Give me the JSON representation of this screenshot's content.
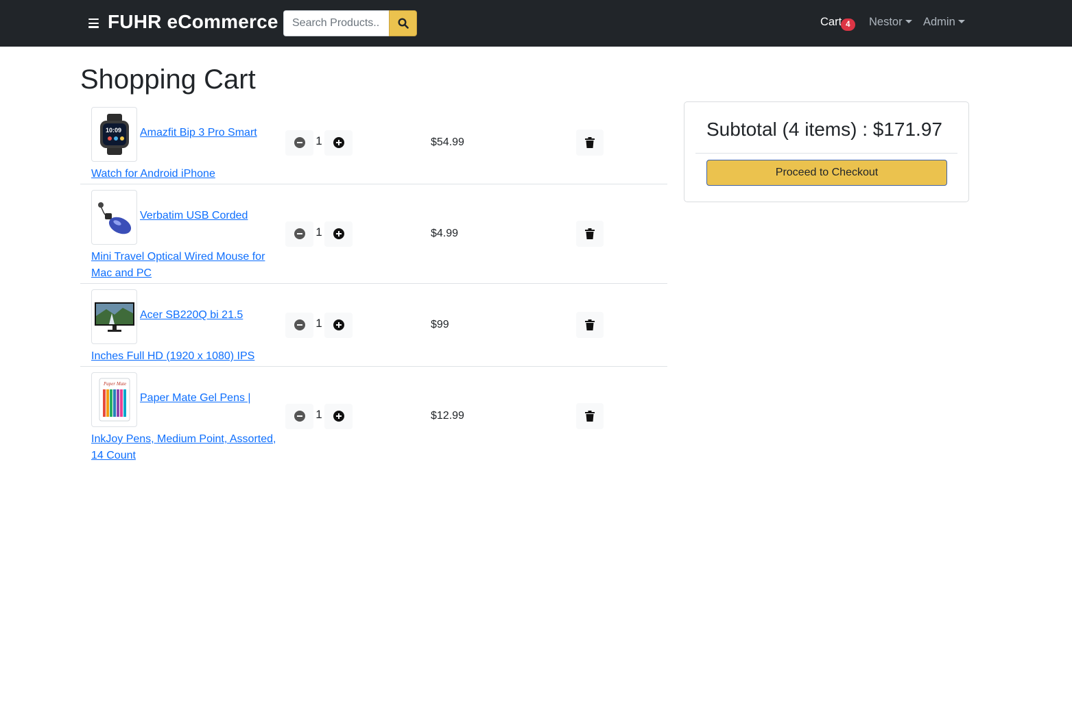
{
  "navbar": {
    "brand": "FUHR eCommerce",
    "search_placeholder": "Search Products..",
    "cart_label": "Cart",
    "cart_count": "4",
    "user_menu": "Nestor",
    "admin_menu": "Admin"
  },
  "page": {
    "title": "Shopping Cart"
  },
  "cart": {
    "items": [
      {
        "name_line1": "Amazfit Bip 3 Pro Smart",
        "name_rest": "Watch for Android iPhone",
        "quantity": "1",
        "price": "$54.99",
        "image_icon": "smartwatch-image"
      },
      {
        "name_line1": "Verbatim USB Corded",
        "name_rest": "Mini Travel Optical Wired Mouse for Mac and PC",
        "quantity": "1",
        "price": "$4.99",
        "image_icon": "mouse-image"
      },
      {
        "name_line1": "Acer SB220Q bi 21.5",
        "name_rest": "Inches Full HD (1920 x 1080) IPS",
        "quantity": "1",
        "price": "$99",
        "image_icon": "monitor-image"
      },
      {
        "name_line1": "Paper Mate Gel Pens |",
        "name_rest": "InkJoy Pens, Medium Point, Assorted, 14 Count",
        "quantity": "1",
        "price": "$12.99",
        "image_icon": "pens-image"
      }
    ]
  },
  "summary": {
    "subtotal_text": "Subtotal (4 items) : $171.97",
    "checkout_label": "Proceed to Checkout"
  },
  "colors": {
    "navbar_bg": "#212529",
    "accent_yellow": "#ebc24e",
    "link_blue": "#0d6efd",
    "badge_red": "#dc3545"
  }
}
